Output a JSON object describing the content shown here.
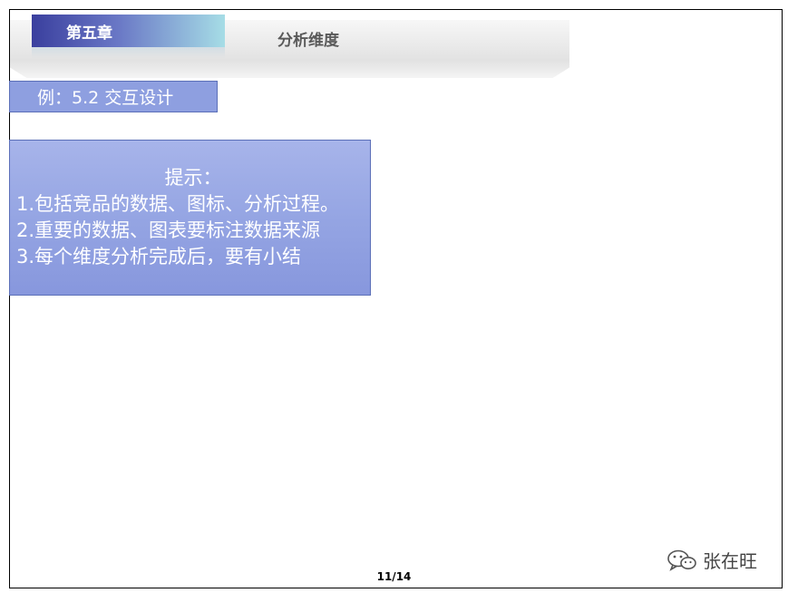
{
  "header": {
    "chapter_label": "第五章",
    "section_title": "分析维度"
  },
  "example_label": "例：5.2 交互设计",
  "hint": {
    "title": "提示：",
    "lines": [
      "1.包括竞品的数据、图标、分析过程。",
      "2.重要的数据、图表要标注数据来源",
      "3.每个维度分析完成后，要有小结"
    ]
  },
  "footer": {
    "page_number": "11/14",
    "watermark_text": "张在旺",
    "watermark_icon": "wechat-icon"
  },
  "colors": {
    "tab_start": "#3a3f9e",
    "tab_end": "#a6dde6",
    "box_fill": "#95a5e3",
    "box_border": "#5b6fb8"
  }
}
